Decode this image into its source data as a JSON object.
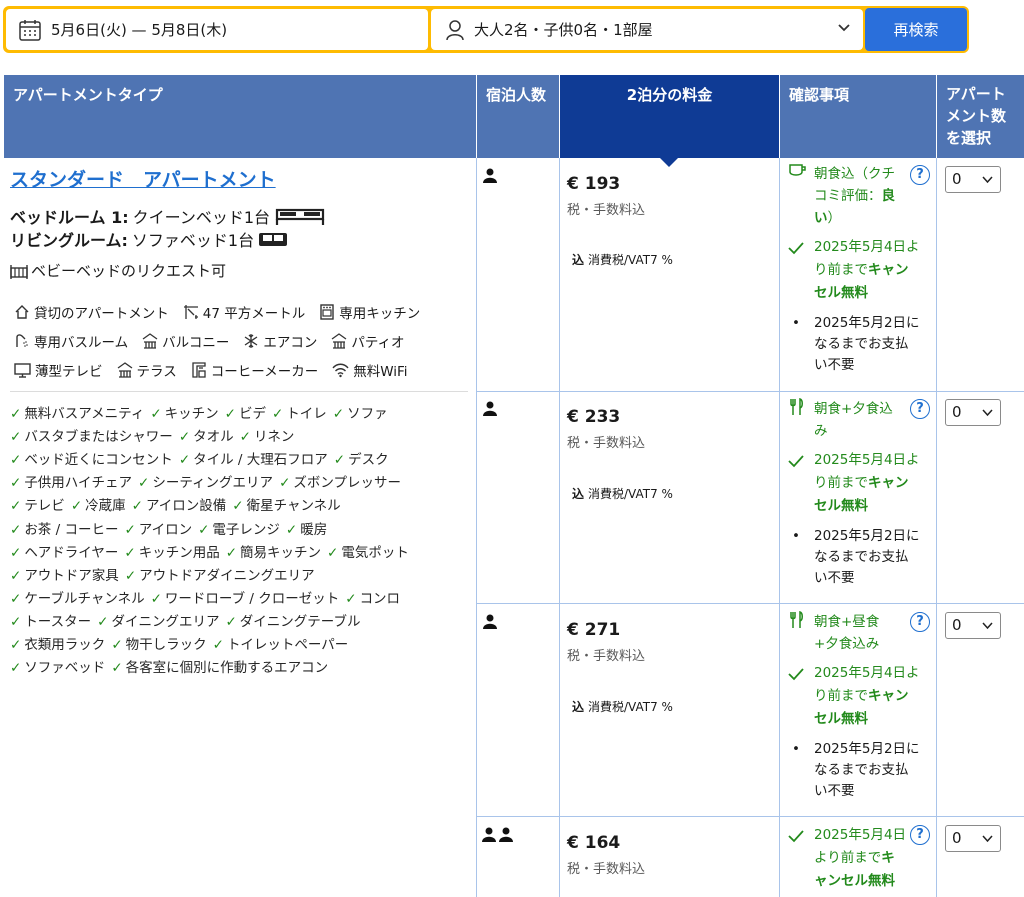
{
  "search": {
    "dates": "5月6日(火) — 5月8日(木)",
    "guests": "大人2名・子供0名・1部屋",
    "button": "再検索"
  },
  "table": {
    "headers": {
      "type": "アパートメントタイプ",
      "occupancy": "宿泊人数",
      "price": "2泊分の料金",
      "conditions": "確認事項",
      "select_line1": "アパート",
      "select_line2": "メント数",
      "select_line3": "を選択"
    }
  },
  "room": {
    "title": "スタンダード　アパートメント",
    "beds": [
      {
        "label": "ベッドルーム 1:",
        "value": "クイーンベッド1台"
      },
      {
        "label": "リビングルーム:",
        "value": "ソファベッド1台"
      }
    ],
    "crib": "ベビーベッドのリクエスト可",
    "facilities": [
      [
        "貸切のアパートメント",
        "47 平方メートル",
        "専用キッチン"
      ],
      [
        "専用バスルーム",
        "バルコニー",
        "エアコン",
        "パティオ"
      ],
      [
        "薄型テレビ",
        "テラス",
        "コーヒーメーカー",
        "無料WiFi"
      ]
    ],
    "amenities": [
      [
        "無料バスアメニティ",
        "キッチン",
        "ビデ",
        "トイレ",
        "ソファ"
      ],
      [
        "バスタブまたはシャワー",
        "タオル",
        "リネン"
      ],
      [
        "ベッド近くにコンセント",
        "タイル / 大理石フロア",
        "デスク"
      ],
      [
        "子供用ハイチェア",
        "シーティングエリア",
        "ズボンプレッサー"
      ],
      [
        "テレビ",
        "冷蔵庫",
        "アイロン設備",
        "衛星チャンネル"
      ],
      [
        "お茶 / コーヒー",
        "アイロン",
        "電子レンジ",
        "暖房"
      ],
      [
        "ヘアドライヤー",
        "キッチン用品",
        "簡易キッチン",
        "電気ポット"
      ],
      [
        "アウトドア家具",
        "アウトドアダイニングエリア"
      ],
      [
        "ケーブルチャンネル",
        "ワードローブ / クローゼット",
        "コンロ"
      ],
      [
        "トースター",
        "ダイニングエリア",
        "ダイニングテーブル"
      ],
      [
        "衣類用ラック",
        "物干しラック",
        "トイレットペーパー"
      ],
      [
        "ソファベッド",
        "各客室に個別に作動するエアコン"
      ]
    ]
  },
  "rates": [
    {
      "guests": 1,
      "price": "€ 193",
      "tax_note": "税・手数料込",
      "vat_tag": "込",
      "vat": "消費税/VAT7 %",
      "meal_line1": "朝食込（クチ",
      "meal_line2a": "コミ評価：",
      "meal_line2b": "良",
      "meal_line3": "い",
      "meal_line3b": "）",
      "cancel_line1": "2025年5月4日よ",
      "cancel_line2a": "り前まで",
      "cancel_line2b": "キャン",
      "cancel_line3": "セル無料",
      "pay_line1": "2025年5月2日に",
      "pay_line2": "なるまでお支払",
      "pay_line3": "い不要",
      "qty": "0"
    },
    {
      "guests": 1,
      "price": "€ 233",
      "tax_note": "税・手数料込",
      "vat_tag": "込",
      "vat": "消費税/VAT7 %",
      "meal_line1": "朝食+夕食込",
      "meal_line2": "み",
      "cancel_line1": "2025年5月4日よ",
      "cancel_line2a": "り前まで",
      "cancel_line2b": "キャン",
      "cancel_line3": "セル無料",
      "pay_line1": "2025年5月2日に",
      "pay_line2": "なるまでお支払",
      "pay_line3": "い不要",
      "qty": "0"
    },
    {
      "guests": 1,
      "price": "€ 271",
      "tax_note": "税・手数料込",
      "vat_tag": "込",
      "vat": "消費税/VAT7 %",
      "meal_line1": "朝食+昼食",
      "meal_line2": "+夕食込み",
      "cancel_line1": "2025年5月4日よ",
      "cancel_line2a": "り前まで",
      "cancel_line2b": "キャン",
      "cancel_line3": "セル無料",
      "pay_line1": "2025年5月2日に",
      "pay_line2": "なるまでお支払",
      "pay_line3": "い不要",
      "qty": "0"
    },
    {
      "guests": 2,
      "price": "€ 164",
      "tax_note": "税・手数料込",
      "cancel_line1": "2025年5月4日",
      "cancel_line2a": "より前まで",
      "cancel_line2b": "キ",
      "cancel_line3": "ャンセル無料",
      "qty": "0"
    }
  ],
  "colors": {
    "header": "#4f74b3",
    "header_active": "#0f3b95",
    "search_border": "#febb02",
    "button": "#2a6fdb",
    "green": "#238a1c",
    "link": "#1f6fcf"
  }
}
